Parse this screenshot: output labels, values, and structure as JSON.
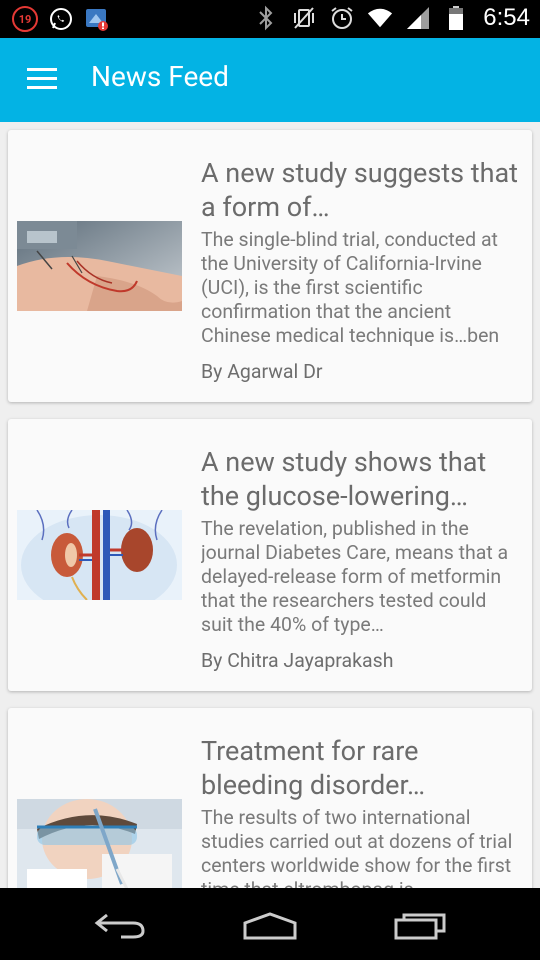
{
  "status_bar": {
    "notification_badge": "19",
    "time": "6:54",
    "icons": [
      "whatsapp-icon",
      "app-update-icon",
      "bluetooth-icon",
      "vibrate-icon",
      "alarm-icon",
      "wifi-icon",
      "signal-icon",
      "battery-icon"
    ]
  },
  "app_bar": {
    "title": "News Feed",
    "menu_icon": "hamburger-menu-icon",
    "color": "#03b3e4"
  },
  "articles": [
    {
      "title": "A new study suggests that a form of…",
      "summary": "The single-blind trial, conducted at the University of California-Irvine (UCI), is the first scientific confirmation that the ancient Chinese medical technique is…ben",
      "author": "By Agarwal Dr",
      "image": "acupuncture-wrist-photo"
    },
    {
      "title": "A new study shows that the glucose-lowering…",
      "summary": "The revelation, published in the journal Diabetes Care, means that a delayed-release form of metformin that the researchers tested could suit the 40% of type…",
      "author": "By Chitra Jayaprakash",
      "image": "kidneys-illustration"
    },
    {
      "title": "Treatment for rare bleeding disorder…",
      "summary": "The results of two international studies carried out at dozens of trial centers worldwide show for the first time that eltrombopag is",
      "author": "",
      "image": "lab-researcher-photo"
    }
  ],
  "nav_bar": {
    "buttons": [
      "back-icon",
      "home-icon",
      "recents-icon"
    ]
  }
}
